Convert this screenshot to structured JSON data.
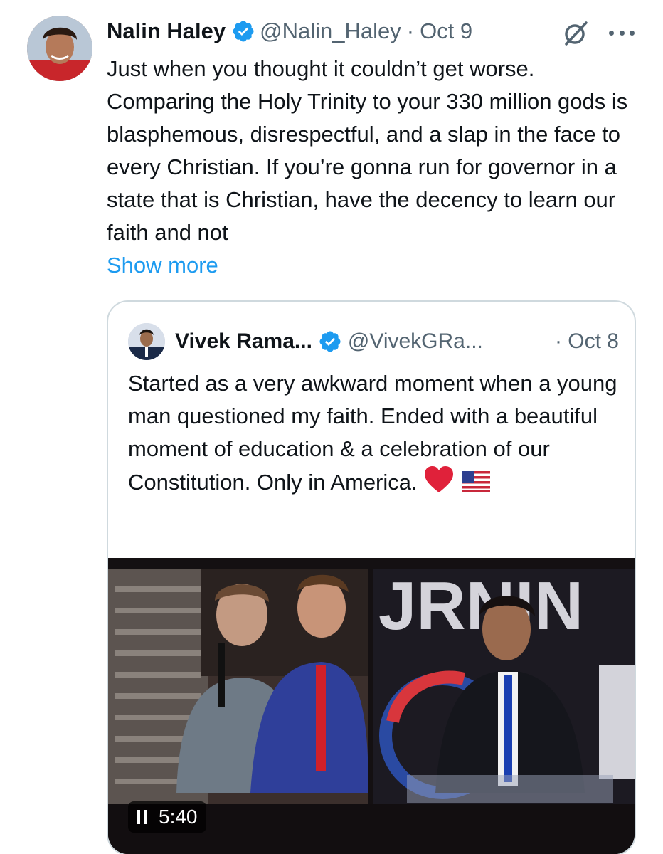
{
  "tweet": {
    "author": {
      "name": "Nalin Haley",
      "handle": "@Nalin_Haley",
      "verified": true,
      "avatar": "avatar-photo-young-man"
    },
    "separator": "·",
    "date": "Oct 9",
    "text": "Just when you thought it couldn’t get worse. Comparing the Holy Trinity to your 330 million gods is blasphemous, disrespectful, and a slap in the face to every Christian. If you’re gonna run for governor in a state that is Christian, have the decency to learn our faith and not",
    "show_more": "Show more",
    "icons": [
      "grok-slash-icon",
      "more-icon"
    ]
  },
  "quoted_tweet": {
    "author": {
      "name": "Vivek Rama...",
      "handle": "@VivekGRa...",
      "verified": true
    },
    "separator": "·",
    "date": "Oct 8",
    "text": "Started as a very awkward moment when a young man questioned my faith. Ended with a beautiful moment of education & a celebration of our Constitution. Only in America.",
    "emojis": [
      "red-heart",
      "us-flag"
    ],
    "video": {
      "duration": "5:40",
      "state": "playing"
    }
  },
  "colors": {
    "text": "#0f1419",
    "muted": "#536471",
    "link": "#1d9bf0",
    "verified": "#1d9bf0",
    "border": "#cfd9de"
  }
}
